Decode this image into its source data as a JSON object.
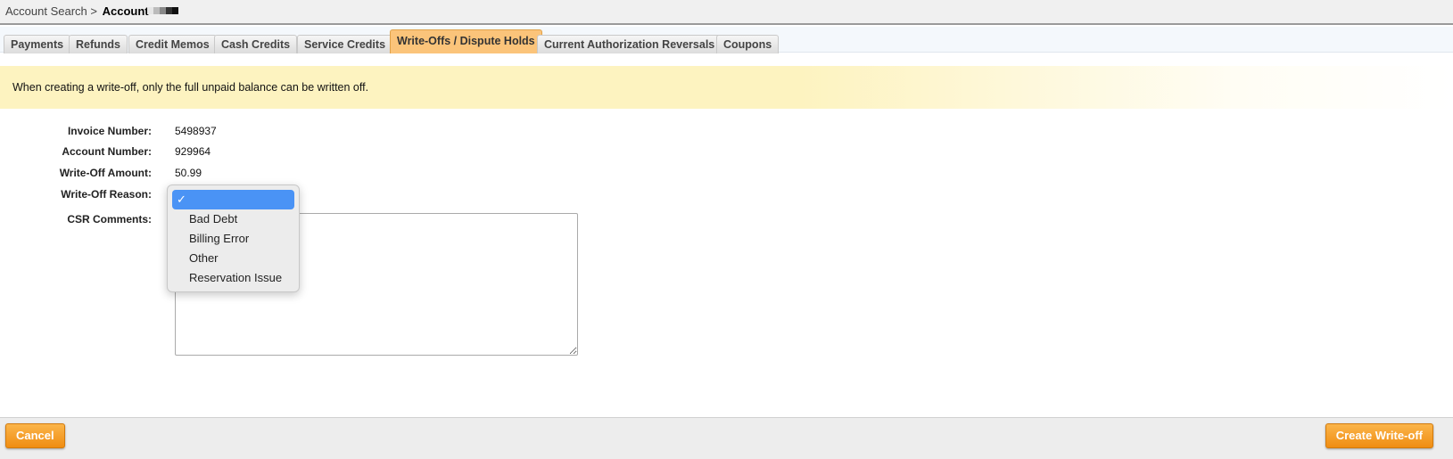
{
  "breadcrumb": {
    "parent": "Account Search >",
    "current": "Account"
  },
  "tabs": [
    {
      "label": "Payments",
      "active": false
    },
    {
      "label": "Refunds",
      "active": false
    },
    {
      "label": "Credit Memos",
      "active": false
    },
    {
      "label": "Cash Credits",
      "active": false
    },
    {
      "label": "Service Credits",
      "active": false
    },
    {
      "label": "Write-Offs / Dispute Holds",
      "active": true
    },
    {
      "label": "Current Authorization Reversals",
      "active": false
    },
    {
      "label": "Coupons",
      "active": false
    }
  ],
  "notice": {
    "text": "When creating a write-off, only the full unpaid balance can be written off."
  },
  "form": {
    "invoice_number_label": "Invoice Number:",
    "invoice_number": "5498937",
    "account_number_label": "Account Number:",
    "account_number": "929964",
    "amount_label": "Write-Off Amount:",
    "amount": "50.99",
    "reason_label": "Write-Off Reason:",
    "comments_label": "CSR Comments:",
    "comments_value": ""
  },
  "reason_dropdown": {
    "selected_mark": "✓",
    "options": [
      "",
      "Bad Debt",
      "Billing Error",
      "Other",
      "Reservation Issue"
    ]
  },
  "footer": {
    "cancel_label": "Cancel",
    "create_label": "Create Write-off"
  },
  "colors": {
    "active_tab": "#fbc47a",
    "notice_bg": "#fdf3c0",
    "button_orange": "#f08d12",
    "selected_option": "#4a93f5"
  }
}
